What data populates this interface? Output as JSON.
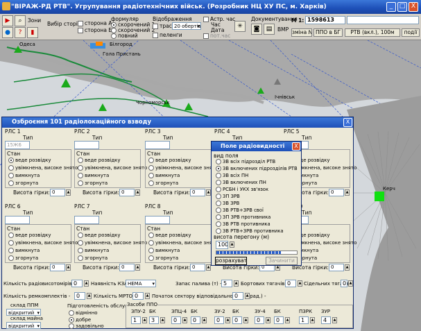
{
  "window": {
    "title": "\"ВІРАЖ-РД РТВ\". Угрупування радіотехнічних військ. (Розробник НЦ ХУ ПС, м. Харків)",
    "min": "_",
    "max": "□",
    "close": "X"
  },
  "toolbar": {
    "zoom_label": "Зони",
    "side_choice_label": "Вибір сторін",
    "side_a": "сторона А",
    "side_b": "сторона Б",
    "form_label": "формуляр",
    "form_opt1": "скорочений 1",
    "form_opt2": "скорочений 2",
    "form_opt3": "повний",
    "display_label": "Відображення",
    "traces": "траси",
    "turns_value": "20 обертів",
    "bearings": "пеленги",
    "astro_label": "Астр. час",
    "time_label": "Час",
    "date_label": "Дата",
    "current_time": "пот.час",
    "doc_label": "Документування",
    "bmp_label": "BMP",
    "scale_prefix": "М 1:",
    "scale_value": "1598613",
    "change_no_label": "зміна №",
    "ppo_label": "ППО в БГ",
    "rtb_label": "РТВ (вкл.), 100м",
    "events_label": "події"
  },
  "map": {
    "cities": [
      "Одеса",
      "Білгород",
      "Гола Пристань",
      "Чорноморськ",
      "Ічнівськ",
      "Керч"
    ]
  },
  "dialog": {
    "title": "Озброєння 101 радіолокаційного взводу",
    "close": "X",
    "tip_label": "Тип",
    "state_label": "Стан",
    "states": [
      "веде розвідку",
      "увімкнена, високе знято",
      "вимкнута",
      "згорнута"
    ],
    "height_label": "Висота гірки:",
    "units": [
      {
        "name": "РЛС 1",
        "type": "15Ж6",
        "height": "0"
      },
      {
        "name": "РЛС 2",
        "type": "",
        "height": "0"
      },
      {
        "name": "РЛС 3",
        "type": "",
        "height": "0"
      },
      {
        "name": "РЛС 4",
        "type": "",
        "height": "0"
      },
      {
        "name": "РЛС 5",
        "type": "",
        "height": "0"
      },
      {
        "name": "РЛС 6",
        "type": "",
        "height": "0"
      },
      {
        "name": "РЛС 7",
        "type": "",
        "height": "0"
      },
      {
        "name": "РЛС 8",
        "type": "",
        "height": "0"
      },
      {
        "name": "РЛС 9",
        "type": "",
        "height": "0"
      },
      {
        "name": "РЛС 10",
        "type": "",
        "height": "0"
      }
    ],
    "row1": {
      "radio_count_label": "Кількість радіовисотомірів -",
      "radio_count": "0",
      "kza_label": "Наявність КЗА",
      "kza_value": "НЕМА",
      "fuel_label": "Запас палива (т) -",
      "fuel": "5",
      "tractors_label": "Бортових тягачів -",
      "tractors": "0",
      "saddle_label": "Сідельних тягачів -",
      "saddle": "0"
    },
    "row2": {
      "repair_label": "Кількість ремкомплектів -",
      "repair": "0",
      "mrto_label": "Кількість МРТО -",
      "mrto": "0",
      "sector_label": "Початок сектору відповідальності з (град.) -",
      "sector": "0"
    },
    "ppm_label": "склад ППМ",
    "ppm_value": "відкритий",
    "crew_label": "склад майна",
    "crew_value": "відкритий",
    "training_label": "Підготовленість обслуги",
    "training_opts": [
      "відмінно",
      "добре",
      "задовільно"
    ],
    "ppo_label": "Засоби ППО",
    "ppo": [
      {
        "name": "ЗПУ-2",
        "val": "1"
      },
      {
        "name": "БК",
        "val": "3"
      },
      {
        "name": "ЗПЦ-4",
        "val": "0"
      },
      {
        "name": "БК",
        "val": "0"
      },
      {
        "name": "ЗУ-2",
        "val": "0"
      },
      {
        "name": "БК",
        "val": "0"
      },
      {
        "name": "ЗУ-4",
        "val": "0"
      },
      {
        "name": "БК",
        "val": "0"
      },
      {
        "name": "ПЗРК",
        "val": "1"
      },
      {
        "name": "ЗУР",
        "val": "4"
      }
    ]
  },
  "popup": {
    "title": "Поле радіовидності",
    "close": "X",
    "group_label": "вид поля",
    "options": [
      "ЗВ всіх підрозділ РТВ",
      "ЗВ включених підрозділів РТВ",
      "ЗВ всіх ПН",
      "ЗВ включених ПН",
      "РСБН і УКХ зв'язок",
      "ЗП ЗРВ",
      "ЗВ ЗРВ",
      "ЗВ РТВ+ЗРВ свої",
      "ЗП ЗРВ противника",
      "ЗВ РТВ противника",
      "ЗВ РТВ+ЗРВ противника"
    ],
    "selected_index": 1,
    "height_label": "висота перегону (м)",
    "height_value": "100",
    "progress": 0.8,
    "calc_button": "розрахувати",
    "remember_button": "Зачинити"
  }
}
